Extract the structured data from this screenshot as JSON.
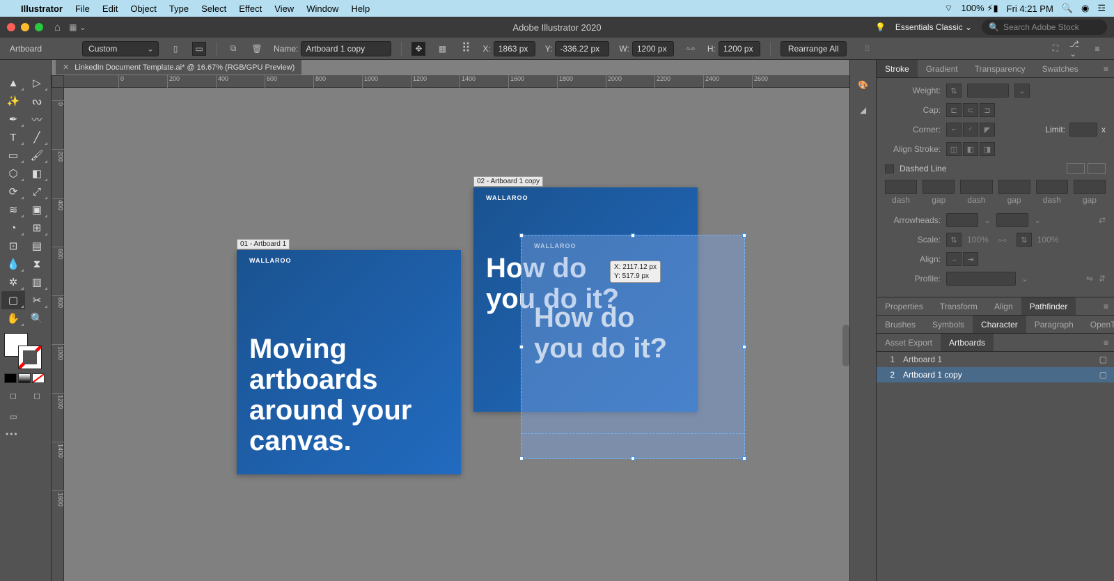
{
  "menubar": {
    "app": "Illustrator",
    "items": [
      "File",
      "Edit",
      "Object",
      "Type",
      "Select",
      "Effect",
      "View",
      "Window",
      "Help"
    ],
    "battery": "100%",
    "clock": "Fri 4:21 PM"
  },
  "chrome": {
    "title": "Adobe Illustrator 2020",
    "workspace": "Essentials Classic",
    "search_placeholder": "Search Adobe Stock"
  },
  "controlbar": {
    "tool": "Artboard",
    "preset": "Custom",
    "name_label": "Name:",
    "name_value": "Artboard 1 copy",
    "x_label": "X:",
    "x_value": "1863 px",
    "y_label": "Y:",
    "y_value": "-336.22 px",
    "w_label": "W:",
    "w_value": "1200 px",
    "h_label": "H:",
    "h_value": "1200 px",
    "rearrange": "Rearrange All"
  },
  "document": {
    "tab": "LinkedIn Document Template.ai* @ 16.67% (RGB/GPU Preview)"
  },
  "ruler_h_ticks": [
    "0",
    "200",
    "400",
    "600",
    "800",
    "1000",
    "1200",
    "1400",
    "1600",
    "1800",
    "2000",
    "2200",
    "2400",
    "2600"
  ],
  "ruler_v_ticks": [
    "0",
    "200",
    "400",
    "600",
    "800",
    "1000",
    "1200",
    "1400",
    "1600"
  ],
  "artboards_canvas": {
    "ab1": {
      "label": "01 - Artboard 1",
      "brand": "WALLAROO",
      "text_lines": [
        "Moving",
        "artboards",
        "around your",
        "canvas."
      ]
    },
    "ab2": {
      "label": "02 - Artboard 1 copy",
      "brand": "WALLAROO",
      "text_lines": [
        "How do",
        "you do it?"
      ]
    },
    "ghost": {
      "brand": "WALLAROO",
      "text_lines": [
        "How do",
        "you do it?"
      ]
    },
    "tooltip": {
      "x": "X: 2117.12 px",
      "y": "Y: 517.9 px"
    }
  },
  "stroke_panel": {
    "tabs": [
      "Stroke",
      "Gradient",
      "Transparency",
      "Swatches"
    ],
    "weight": "Weight:",
    "cap": "Cap:",
    "corner": "Corner:",
    "limit": "Limit:",
    "limit_x": "x",
    "align": "Align Stroke:",
    "dashed": "Dashed Line",
    "dash_labels": [
      "dash",
      "gap",
      "dash",
      "gap",
      "dash",
      "gap"
    ],
    "arrowheads": "Arrowheads:",
    "scale": "Scale:",
    "scale_val": "100%",
    "align2": "Align:",
    "profile": "Profile:"
  },
  "props_tabs": [
    "Properties",
    "Transform",
    "Align",
    "Pathfinder"
  ],
  "brush_tabs": [
    "Brushes",
    "Symbols",
    "Character",
    "Paragraph",
    "OpenType"
  ],
  "artboards_panel": {
    "tabs": [
      "Asset Export",
      "Artboards"
    ],
    "rows": [
      {
        "num": "1",
        "name": "Artboard 1"
      },
      {
        "num": "2",
        "name": "Artboard 1 copy"
      }
    ]
  }
}
